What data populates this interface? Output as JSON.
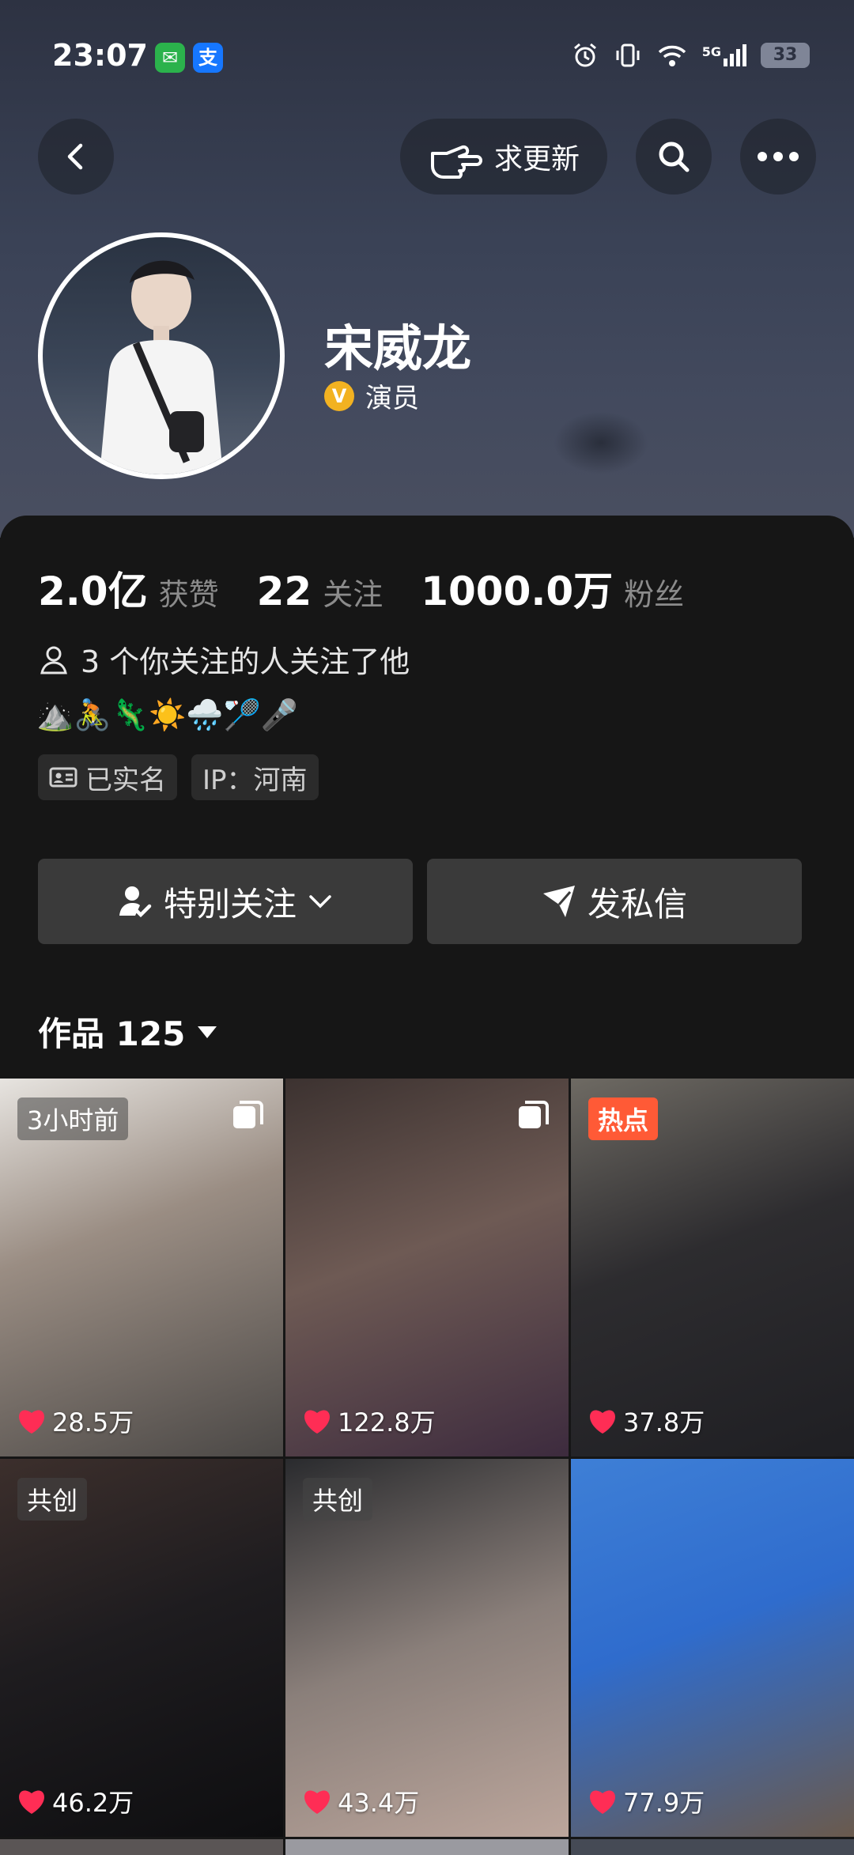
{
  "status": {
    "time": "23:07",
    "battery": "33",
    "network": "5G"
  },
  "header": {
    "update_label": "求更新"
  },
  "profile": {
    "name": "宋威龙",
    "verified_title": "演员"
  },
  "stats": [
    {
      "value": "2.0亿",
      "label": "获赞"
    },
    {
      "value": "22",
      "label": "关注"
    },
    {
      "value": "1000.0万",
      "label": "粉丝"
    }
  ],
  "mutual_text": "3 个你关注的人关注了他",
  "emojis": "⛰️🚴🦎☀️🌧️🏸🎤",
  "tags": {
    "realname": "已实名",
    "ip": "IP：河南"
  },
  "actions": {
    "follow_label": "特别关注",
    "message_label": "发私信"
  },
  "works": {
    "label": "作品 125"
  },
  "videos": [
    {
      "badge": "3小时前",
      "likes": "28.5万"
    },
    {
      "badge": "",
      "likes": "122.8万"
    },
    {
      "badge": "热点",
      "likes": "37.8万"
    },
    {
      "badge": "共创",
      "likes": "46.2万"
    },
    {
      "badge": "共创",
      "likes": "43.4万"
    },
    {
      "badge": "",
      "likes": "77.9万"
    }
  ],
  "colors": {
    "background": "#161616",
    "hot_badge": "#ff5a36",
    "like_heart": "#ff2d55",
    "verified": "#f2b221"
  }
}
